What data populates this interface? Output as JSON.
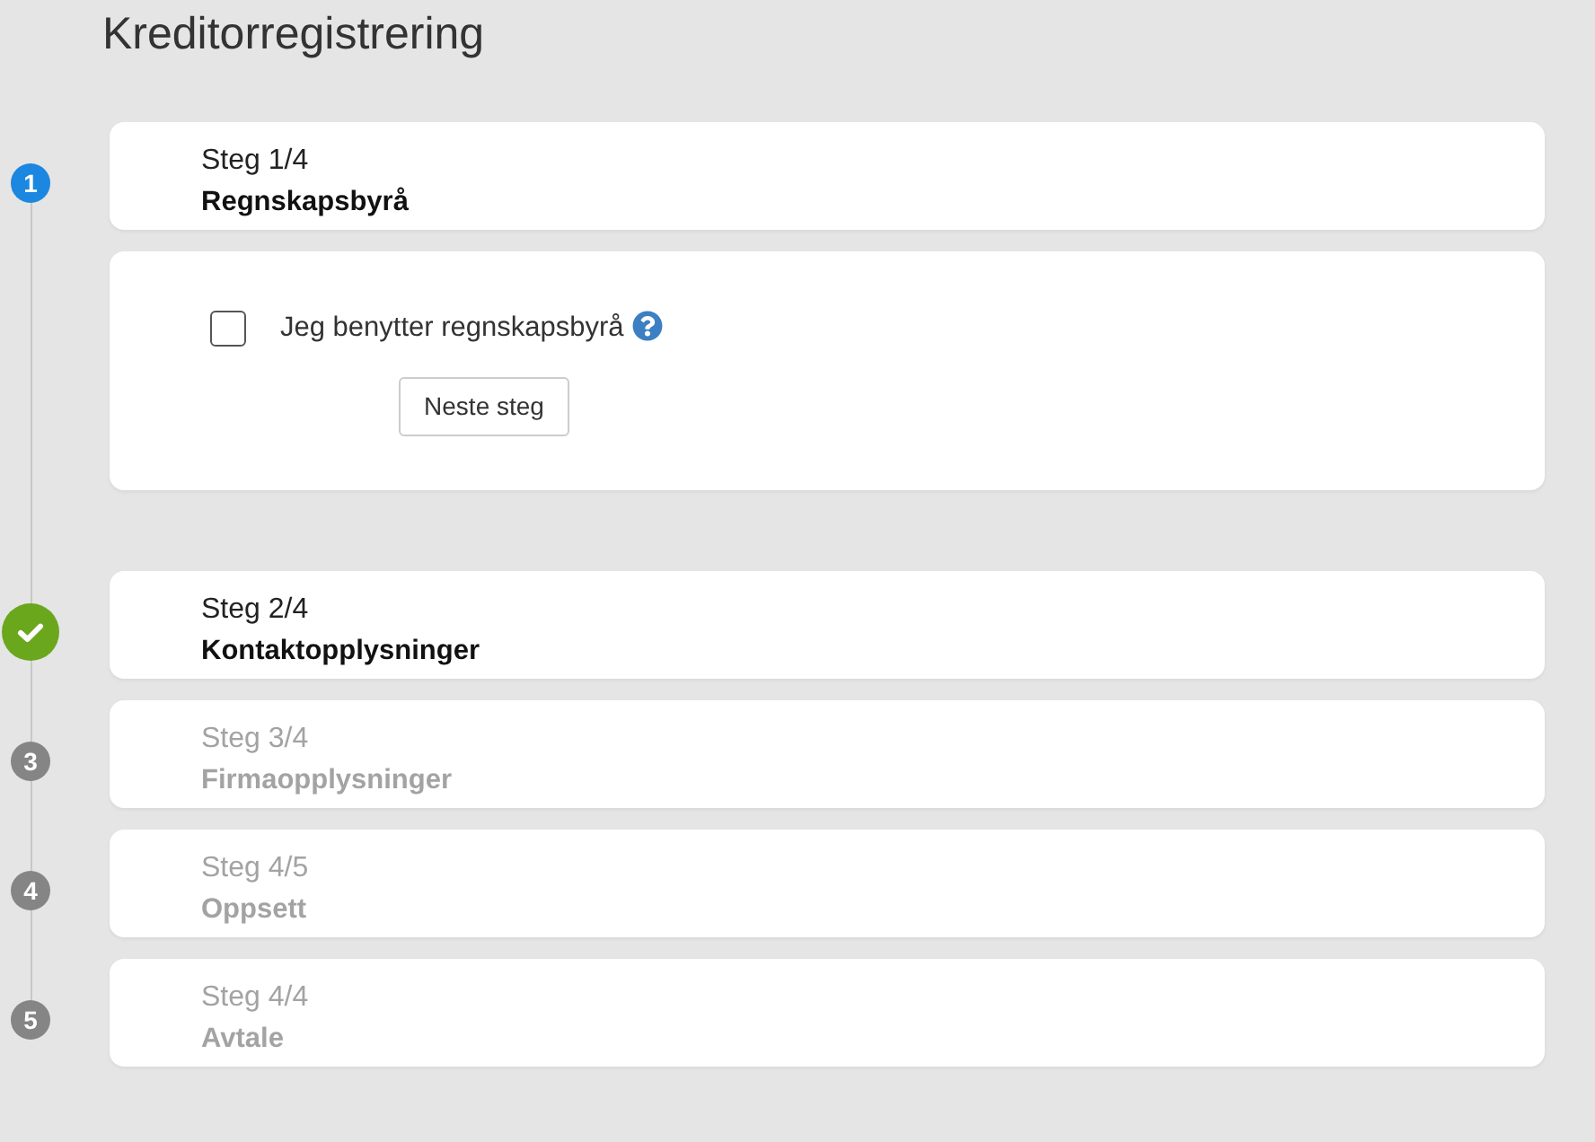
{
  "page": {
    "title": "Kreditorregistrering"
  },
  "steps": [
    {
      "number": "1",
      "label": "Steg 1/4",
      "title": "Regnskapsbyrå",
      "selected": true,
      "completed": false,
      "expanded": true,
      "body": {
        "checkbox": {
          "label": "Jeg benytter regnskapsbyrå",
          "checked": false
        },
        "button": "Neste steg"
      }
    },
    {
      "label": "Steg 2/4",
      "title": "Kontaktopplysninger",
      "selected": false,
      "completed": true,
      "expanded": false
    },
    {
      "number": "3",
      "label": "Steg 3/4",
      "title": "Firmaopplysninger",
      "selected": false,
      "completed": false,
      "expanded": false
    },
    {
      "number": "4",
      "label": "Steg 4/5",
      "title": "Oppsett",
      "selected": false,
      "completed": false,
      "expanded": false
    },
    {
      "number": "5",
      "label": "Steg 4/4",
      "title": "Avtale",
      "selected": false,
      "completed": false,
      "expanded": false
    }
  ]
}
